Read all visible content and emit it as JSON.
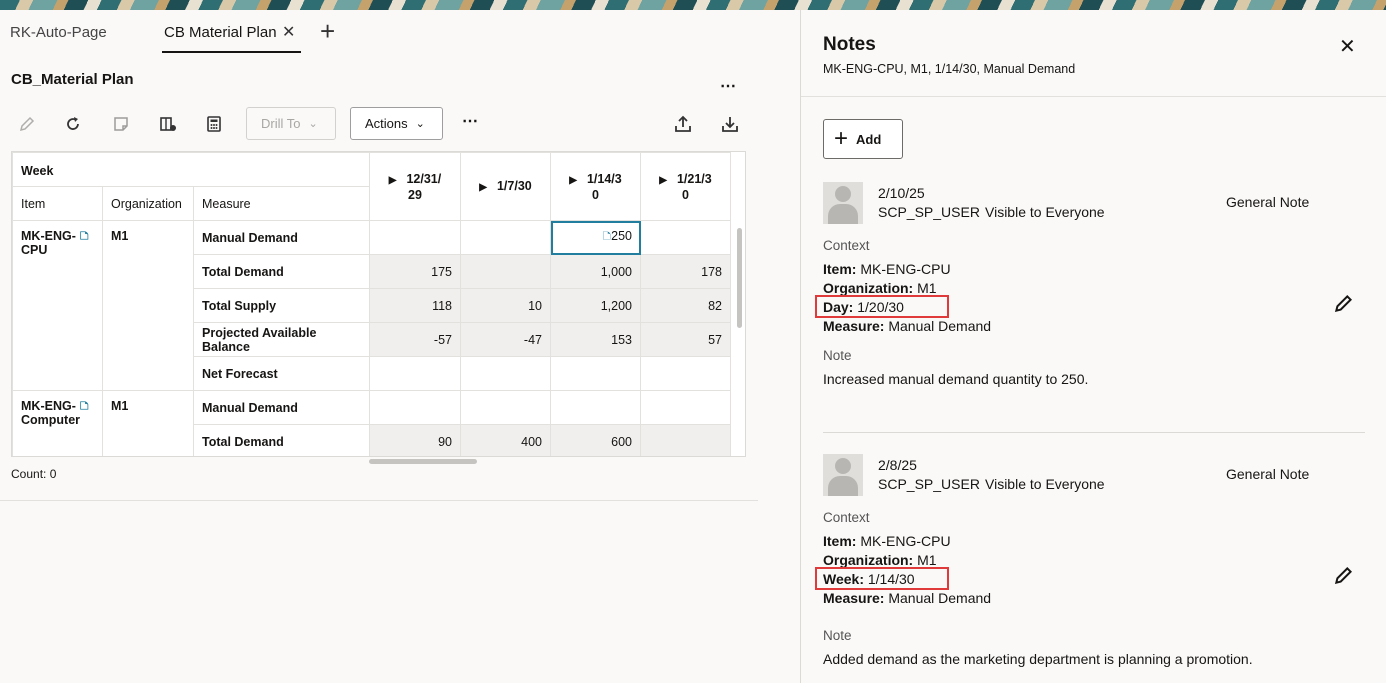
{
  "tabs": [
    {
      "label": "RK-Auto-Page"
    },
    {
      "label": "CB Material Plan"
    }
  ],
  "page": {
    "title": "CB_Material Plan",
    "count": "Count: 0"
  },
  "toolbar": {
    "drill_to": "Drill To",
    "actions": "Actions"
  },
  "grid": {
    "week_label": "Week",
    "col_item": "Item",
    "col_org": "Organization",
    "col_measure": "Measure",
    "dates": [
      {
        "line1": "12/31/",
        "line2": "29"
      },
      {
        "line1": "1/7/30",
        "line2": ""
      },
      {
        "line1": "1/14/3",
        "line2": "0"
      },
      {
        "line1": "1/21/3",
        "line2": "0"
      }
    ],
    "groups": [
      {
        "item_line1": "MK-ENG-",
        "item_line2": "CPU",
        "org": "M1"
      },
      {
        "item_line1": "MK-ENG-",
        "item_line2": "Computer",
        "org": "M1"
      }
    ],
    "rows": [
      {
        "measure": "Manual Demand",
        "values": [
          "",
          "",
          "250",
          ""
        ]
      },
      {
        "measure": "Total Demand",
        "values": [
          "175",
          "",
          "1,000",
          "178"
        ]
      },
      {
        "measure": "Total Supply",
        "values": [
          "118",
          "10",
          "1,200",
          "82"
        ]
      },
      {
        "measure": "Projected Available Balance",
        "values": [
          "-57",
          "-47",
          "153",
          "57"
        ]
      },
      {
        "measure": "Net Forecast",
        "values": [
          "",
          "",
          "",
          ""
        ]
      },
      {
        "measure": "Manual Demand",
        "values": [
          "",
          "",
          "",
          ""
        ]
      },
      {
        "measure": "Total Demand",
        "values": [
          "90",
          "400",
          "600",
          ""
        ]
      }
    ]
  },
  "notes": {
    "title": "Notes",
    "subtitle": "MK-ENG-CPU, M1, 1/14/30, Manual Demand",
    "add_label": "Add",
    "items": [
      {
        "date": "2/10/25",
        "user": "SCP_SP_USER",
        "visibility": "Visible to Everyone",
        "type": "General Note",
        "context_label": "Context",
        "item_key": "Item:",
        "item_val": " MK-ENG-CPU",
        "org_key": "Organization:",
        "org_val": " M1",
        "time_key": "Day:",
        "time_val": " 1/20/30",
        "measure_key": "Measure:",
        "measure_val": " Manual Demand",
        "note_label": "Note",
        "text": "Increased manual demand quantity to 250."
      },
      {
        "date": "2/8/25",
        "user": "SCP_SP_USER",
        "visibility": "Visible to Everyone",
        "type": "General Note",
        "context_label": "Context",
        "item_key": "Item:",
        "item_val": " MK-ENG-CPU",
        "org_key": "Organization:",
        "org_val": " M1",
        "time_key": "Week:",
        "time_val": " 1/14/30",
        "measure_key": "Measure:",
        "measure_val": " Manual Demand",
        "note_label": "Note",
        "text": "Added demand as the marketing department is planning a promotion."
      }
    ]
  },
  "colors": {
    "accent": "#227e9e",
    "highlight": "#e03a3a"
  }
}
